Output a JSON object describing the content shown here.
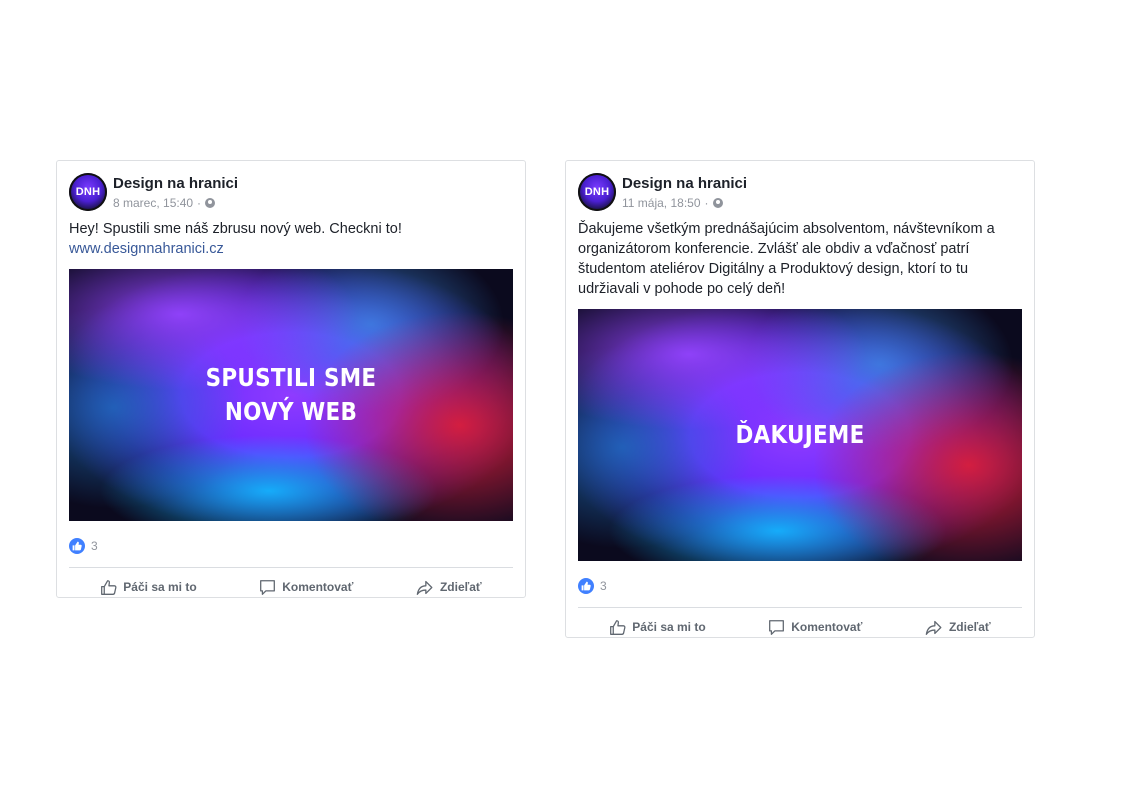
{
  "posts": [
    {
      "page_name": "Design na hranici",
      "avatar_text": "DNH",
      "timestamp": "8 marec, 15:40",
      "separator": "·",
      "text": "Hey! Spustili sme náš zbrusu nový web. Checkni to!",
      "link": "www.designnahranici.cz",
      "image_lines": [
        "SPUSTILI SME",
        "NOVÝ WEB"
      ],
      "reaction_count": "3",
      "actions": {
        "like": "Páči sa mi to",
        "comment": "Komentovať",
        "share": "Zdieľať"
      }
    },
    {
      "page_name": "Design na hranici",
      "avatar_text": "DNH",
      "timestamp": "11 mája, 18:50",
      "separator": "·",
      "text": "Ďakujeme všetkým prednášajúcim absolventom, návštevníkom a organizátorom konferencie. Zvlášť ale obdiv a vďačnosť patrí študentom ateliérov Digitálny a Produktový design, ktorí to tu udržiavali v pohode po celý deň!",
      "image_lines": [
        "ĎAKUJEME"
      ],
      "reaction_count": "3",
      "actions": {
        "like": "Páči sa mi to",
        "comment": "Komentovať",
        "share": "Zdieľať"
      }
    }
  ],
  "colors": {
    "link": "#385898",
    "like_blue": "#4080ff",
    "muted": "#90949c",
    "action_text": "#606770"
  },
  "icons": {
    "privacy": "globe-icon",
    "reaction": "like-reaction-icon",
    "like": "thumbs-up-icon",
    "comment": "comment-icon",
    "share": "share-arrow-icon"
  }
}
